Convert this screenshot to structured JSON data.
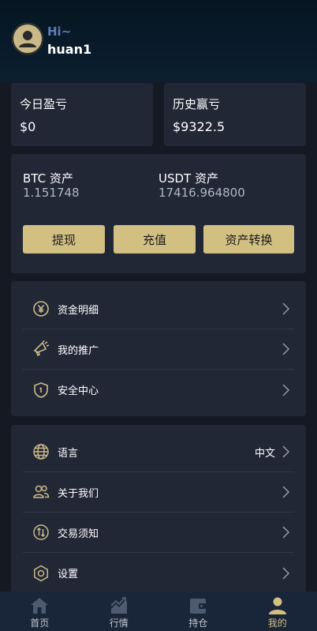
{
  "profile": {
    "greeting": "Hi~",
    "username": "huan1"
  },
  "pnl": {
    "today_label": "今日盈亏",
    "today_value": "$0",
    "history_label": "历史赢亏",
    "history_value": "$9322.5"
  },
  "assets": {
    "btc_label": "BTC 资产",
    "btc_value": "1.151748",
    "usdt_label": "USDT 资产",
    "usdt_value": "17416.964800",
    "withdraw_label": "提现",
    "deposit_label": "充值",
    "transfer_label": "资产转换"
  },
  "menu1": {
    "items": [
      {
        "label": "资金明细",
        "icon": "yuan-coin-icon"
      },
      {
        "label": "我的推广",
        "icon": "megaphone-icon"
      },
      {
        "label": "安全中心",
        "icon": "shield-icon"
      }
    ]
  },
  "menu2": {
    "items": [
      {
        "label": "语言",
        "value": "中文",
        "icon": "globe-icon"
      },
      {
        "label": "关于我们",
        "icon": "users-icon"
      },
      {
        "label": "交易须知",
        "icon": "exchange-icon"
      },
      {
        "label": "设置",
        "icon": "gear-icon"
      }
    ]
  },
  "tabbar": {
    "items": [
      {
        "label": "首页",
        "icon": "home-icon"
      },
      {
        "label": "行情",
        "icon": "chart-icon"
      },
      {
        "label": "持仓",
        "icon": "wallet-icon"
      },
      {
        "label": "我的",
        "icon": "person-icon",
        "active": true
      }
    ]
  },
  "colors": {
    "accent": "#d2bf82",
    "card": "#222736",
    "background": "#141924",
    "tabbar": "#192539",
    "greeting": "#5c7fb3"
  }
}
